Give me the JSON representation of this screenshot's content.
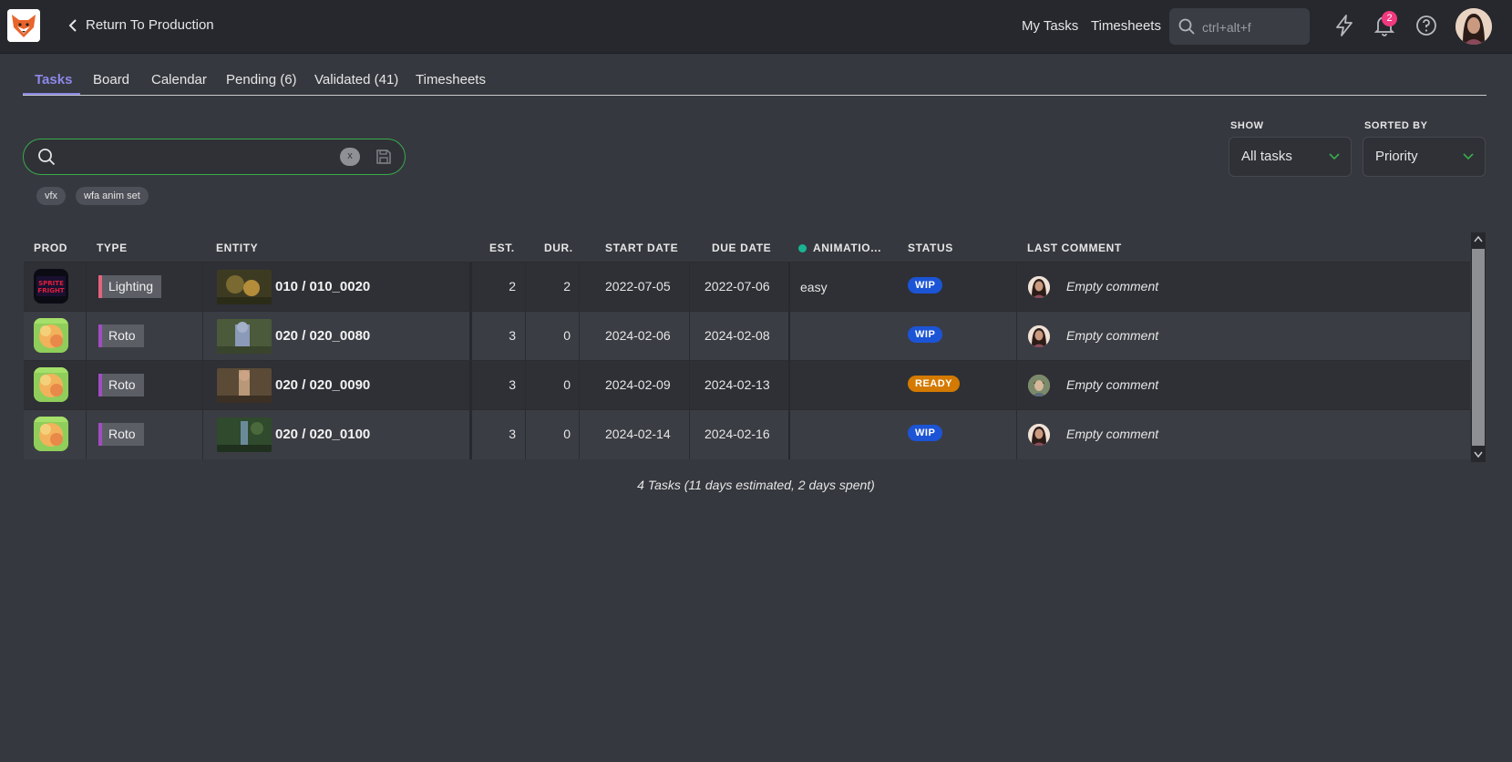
{
  "topbar": {
    "back_label": "Return To Production",
    "nav": [
      "My Tasks",
      "Timesheets"
    ],
    "search_placeholder": "ctrl+alt+f",
    "notification_count": "2"
  },
  "tabs": [
    "Tasks",
    "Board",
    "Calendar",
    "Pending (6)",
    "Validated (41)",
    "Timesheets"
  ],
  "search": {
    "value": "",
    "clear_label": "x"
  },
  "chips": [
    "vfx",
    "wfa anim set"
  ],
  "filters": {
    "show_label": "SHOW",
    "show_value": "All tasks",
    "sort_label": "SORTED BY",
    "sort_value": "Priority"
  },
  "table": {
    "headers": {
      "prod": "PROD",
      "type": "TYPE",
      "entity": "ENTITY",
      "est": "EST.",
      "dur": "DUR.",
      "start": "START DATE",
      "due": "DUE DATE",
      "anim": "ANIMATIO...",
      "status": "STATUS",
      "comment": "LAST COMMENT"
    },
    "anim_dot_color": "#1ab394",
    "rows": [
      {
        "type": "Lighting",
        "type_color": "#e4647d",
        "entity": "010 / 010_0020",
        "est": "2",
        "dur": "2",
        "start": "2022-07-05",
        "due": "2022-07-06",
        "anim": "easy",
        "status": "WIP",
        "status_color": "#1c54d6",
        "comment": "Empty comment"
      },
      {
        "type": "Roto",
        "type_color": "#a24cc2",
        "entity": "020 / 020_0080",
        "est": "3",
        "dur": "0",
        "start": "2024-02-06",
        "due": "2024-02-08",
        "anim": "",
        "status": "WIP",
        "status_color": "#1c54d6",
        "comment": "Empty comment"
      },
      {
        "type": "Roto",
        "type_color": "#a24cc2",
        "entity": "020 / 020_0090",
        "est": "3",
        "dur": "0",
        "start": "2024-02-09",
        "due": "2024-02-13",
        "anim": "",
        "status": "READY",
        "status_color": "#d47a00",
        "comment": "Empty comment"
      },
      {
        "type": "Roto",
        "type_color": "#a24cc2",
        "entity": "020 / 020_0100",
        "est": "3",
        "dur": "0",
        "start": "2024-02-14",
        "due": "2024-02-16",
        "anim": "",
        "status": "WIP",
        "status_color": "#1c54d6",
        "comment": "Empty comment"
      }
    ]
  },
  "footer": "4 Tasks (11 days estimated, 2 days spent)"
}
